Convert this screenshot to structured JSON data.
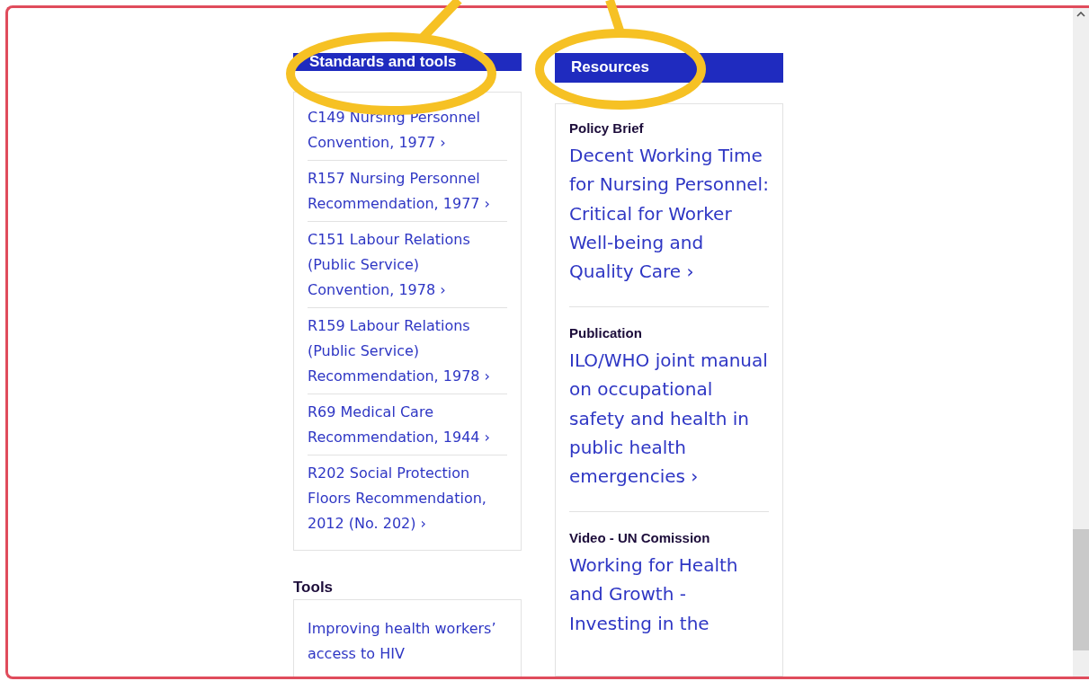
{
  "columns": [
    {
      "heading": "Standards and tools",
      "kind": "links",
      "items": [
        {
          "text": "C149 Nursing Personnel Convention, 1977 ›"
        },
        {
          "text": "R157 Nursing Personnel Recommendation, 1977 ›"
        },
        {
          "text": "C151 Labour Relations (Public Service) Convention, 1978 ›"
        },
        {
          "text": "R159 Labour Relations (Public Service) Recommendation, 1978 ›"
        },
        {
          "text": "R69 Medical Care Recommendation, 1944 ›"
        },
        {
          "text": "R202 Social Protection Floors Recommendation, 2012 (No. 202) ›"
        }
      ],
      "subsection": {
        "title": "Tools",
        "items": [
          {
            "text": "Improving health workers’ access to HIV"
          }
        ]
      }
    },
    {
      "heading": "Resources",
      "kind": "resources",
      "items": [
        {
          "label": "Policy Brief",
          "text": "Decent Working Time for Nursing Personnel: Critical for Worker Well-being and Quality Care ›"
        },
        {
          "label": "Publication",
          "text": "ILO/WHO joint manual on occupational safety and health in public health emergencies ›"
        },
        {
          "label": "Video - UN Comission",
          "text": "Working for Health and Growth - Investing in the"
        }
      ]
    }
  ]
}
